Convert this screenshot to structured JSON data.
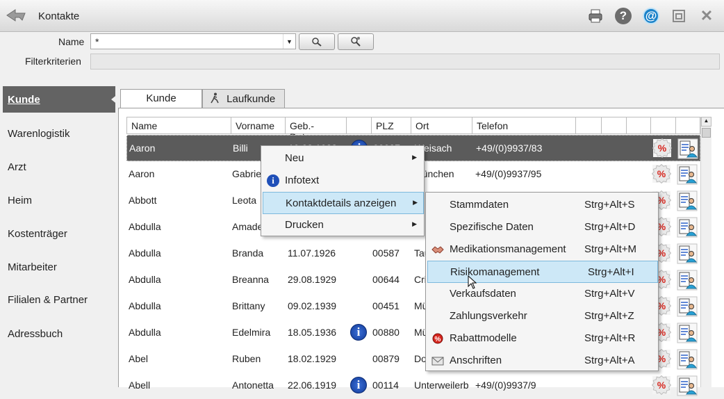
{
  "window": {
    "title": "Kontakte"
  },
  "toolbar": {
    "icons": [
      "print-icon",
      "help-icon",
      "email-icon",
      "window-icon",
      "close-icon"
    ],
    "help_glyph": "?",
    "email_glyph": "@",
    "close_glyph": "✕"
  },
  "search": {
    "name_label": "Name",
    "name_value": "*",
    "filter_label": "Filterkriterien",
    "filter_value": ""
  },
  "sidebar": {
    "items": [
      {
        "label": "Kunde",
        "active": true
      },
      {
        "label": "Warenlogistik"
      },
      {
        "label": "Arzt"
      },
      {
        "label": "Heim"
      },
      {
        "label": "Kostenträger"
      },
      {
        "label": "Mitarbeiter"
      },
      {
        "label": "Filialen & Partner"
      },
      {
        "label": "Adressbuch"
      }
    ]
  },
  "tabs": [
    {
      "label": "Kunde",
      "active": true
    },
    {
      "label": "Laufkunde"
    }
  ],
  "table": {
    "columns": [
      "Name",
      "Vorname",
      "Geb.-Datum",
      "",
      "PLZ",
      "Ort",
      "Telefon"
    ],
    "rows": [
      {
        "name": "Aaron",
        "vorname": "Billi",
        "geb": "19.03.1922",
        "info": true,
        "plz": "00037",
        "ort": "Weisach",
        "tel": "+49/(0)9937/83",
        "selected": true
      },
      {
        "name": "Aaron",
        "vorname": "Gabriele",
        "geb": "",
        "info": false,
        "plz": "",
        "ort": "München",
        "tel": "+49/(0)9937/95"
      },
      {
        "name": "Abbott",
        "vorname": "Leota",
        "geb": "",
        "info": false,
        "plz": "",
        "ort": "",
        "tel": ""
      },
      {
        "name": "Abdulla",
        "vorname": "Amadeus",
        "geb": "",
        "info": false,
        "plz": "",
        "ort": "",
        "tel": ""
      },
      {
        "name": "Abdulla",
        "vorname": "Branda",
        "geb": "11.07.1926",
        "info": false,
        "plz": "00587",
        "ort": "Tau",
        "tel": ""
      },
      {
        "name": "Abdulla",
        "vorname": "Breanna",
        "geb": "29.08.1929",
        "info": false,
        "plz": "00644",
        "ort": "Cri",
        "tel": ""
      },
      {
        "name": "Abdulla",
        "vorname": "Brittany",
        "geb": "09.02.1939",
        "info": false,
        "plz": "00451",
        "ort": "Mü",
        "tel": ""
      },
      {
        "name": "Abdulla",
        "vorname": "Edelmira",
        "geb": "18.05.1936",
        "info": true,
        "plz": "00880",
        "ort": "Mü",
        "tel": ""
      },
      {
        "name": "Abel",
        "vorname": "Ruben",
        "geb": "18.02.1929",
        "info": false,
        "plz": "00879",
        "ort": "Do",
        "tel": ""
      },
      {
        "name": "Abell",
        "vorname": "Antonetta",
        "geb": "22.06.1919",
        "info": true,
        "plz": "00114",
        "ort": "Unterweilerb",
        "tel": "+49/(0)9937/9"
      }
    ]
  },
  "context_menu": {
    "items": [
      {
        "label": "Neu",
        "submenu": true,
        "icon": ""
      },
      {
        "label": "Infotext",
        "submenu": false,
        "icon": "info-icon"
      },
      {
        "label": "Kontaktdetails anzeigen",
        "submenu": true,
        "icon": "",
        "highlighted": true
      },
      {
        "label": "Drucken",
        "submenu": true,
        "icon": ""
      }
    ]
  },
  "submenu": {
    "items": [
      {
        "label": "Stammdaten",
        "shortcut": "Strg+Alt+S",
        "icon": ""
      },
      {
        "label": "Spezifische Daten",
        "shortcut": "Strg+Alt+D",
        "icon": ""
      },
      {
        "label": "Medikationsmanagement",
        "shortcut": "Strg+Alt+M",
        "icon": "handshake-icon"
      },
      {
        "label": "Risikomanagement",
        "shortcut": "Strg+Alt+I",
        "icon": "",
        "highlighted": true
      },
      {
        "label": "Verkaufsdaten",
        "shortcut": "Strg+Alt+V",
        "icon": ""
      },
      {
        "label": "Zahlungsverkehr",
        "shortcut": "Strg+Alt+Z",
        "icon": ""
      },
      {
        "label": "Rabattmodelle",
        "shortcut": "Strg+Alt+R",
        "icon": "discount-seal-icon"
      },
      {
        "label": "Anschriften",
        "shortcut": "Strg+Alt+A",
        "icon": "envelope-icon"
      }
    ]
  },
  "colors": {
    "accent": "#3b6fd6",
    "selected_row": "#5b5b5b",
    "menu_highlight": "#cde8f7",
    "discount_red": "#d7261e"
  },
  "info_glyph": "i",
  "pct_glyph": "%"
}
